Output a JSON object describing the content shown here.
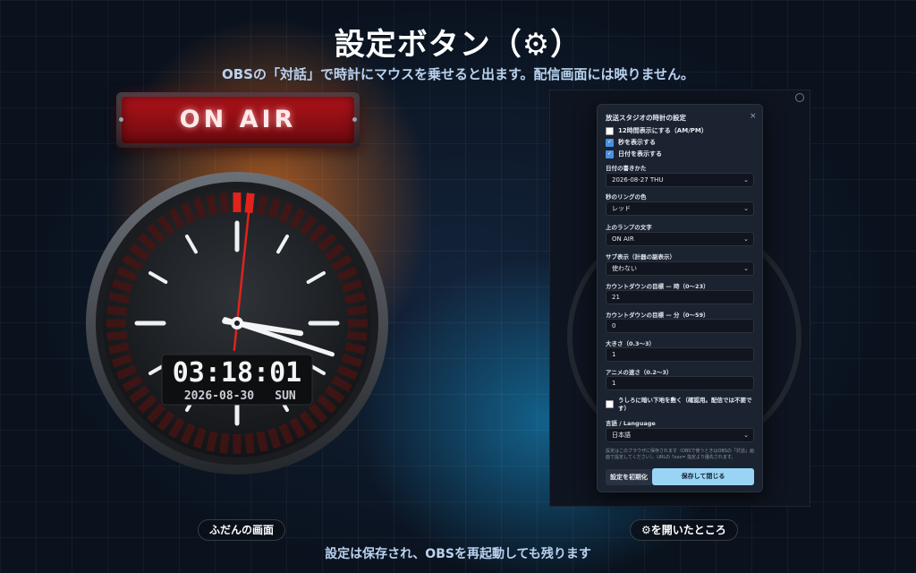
{
  "title": "設定ボタン（⚙）",
  "subtitle": "OBSの「対話」で時計にマウスを乗せると出ます。配信画面には映りません。",
  "footer": "設定は保存され、OBSを再起動しても残ります",
  "left_caption": "ふだんの画面",
  "right_caption": "⚙を開いたところ",
  "lamp_text": "ON AIR",
  "clock": {
    "time": "03:18:01",
    "date": "2026-08-30",
    "weekday": "SUN",
    "hour": 3,
    "minute": 18,
    "second": 1,
    "ring_color": "#e0231b"
  },
  "dialog": {
    "title": "放送スタジオの時計の設定",
    "close": "×",
    "check_12h": "12時間表示にする（AM/PM）",
    "check_12h_checked": false,
    "check_seconds": "秒を表示する",
    "check_seconds_checked": true,
    "check_date": "日付を表示する",
    "check_date_checked": true,
    "date_format_label": "日付の書きかた",
    "date_format_value": "2026-08-27 THU",
    "ring_color_label": "秒のリングの色",
    "ring_color_value": "レッド",
    "lamp_text_label": "上のランプの文字",
    "lamp_text_value": "ON AIR",
    "sub_display_label": "サブ表示（計器の副表示）",
    "sub_display_value": "使わない",
    "countdown_hour_label": "カウントダウンの目標 — 時（0〜23）",
    "countdown_hour_value": "21",
    "countdown_min_label": "カウントダウンの目標 — 分（0〜59）",
    "countdown_min_value": "0",
    "size_label": "大きさ（0.3〜3）",
    "size_value": "1",
    "anim_label": "アニメの速さ（0.2〜3）",
    "anim_value": "1",
    "check_bg": "うしろに暗い下地を敷く（確認用。配信では不要です）",
    "check_bg_checked": false,
    "language_label": "言語 / Language",
    "language_value": "日本語",
    "note": "設定はこのブラウザに保存されます（OBSで使うときはOBSの「対話」画面で設定してください）。URLの ?xxx= 指定より優先されます。",
    "reset_button": "設定を初期化",
    "save_button": "保存して閉じる"
  }
}
